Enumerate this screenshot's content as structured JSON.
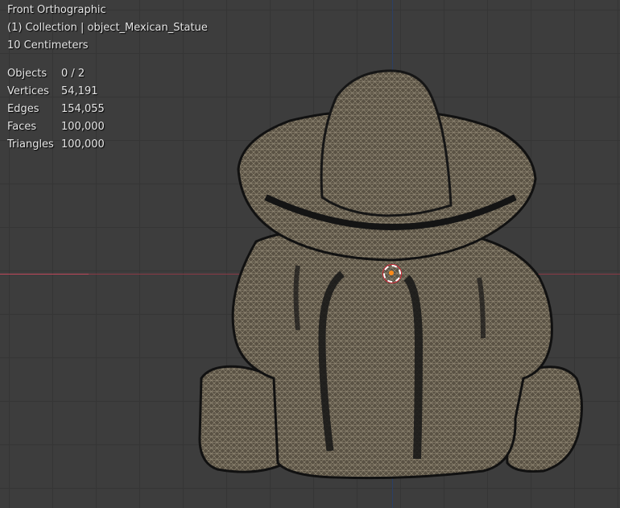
{
  "viewport": {
    "view_name": "Front Orthographic",
    "collection_label": "(1) Collection | object_Mexican_Statue",
    "scale_label": "10 Centimeters"
  },
  "stats": [
    {
      "label": "Objects",
      "value": "0 / 2"
    },
    {
      "label": "Vertices",
      "value": "54,191"
    },
    {
      "label": "Edges",
      "value": "154,055"
    },
    {
      "label": "Faces",
      "value": "100,000"
    },
    {
      "label": "Triangles",
      "value": "100,000"
    }
  ],
  "colors": {
    "background": "#3d3d3d",
    "x_axis": "#c0475a",
    "z_axis": "#2b3f66",
    "origin": "#ff8c1a"
  },
  "icons": [
    "object-origin-icon",
    "3d-cursor-icon"
  ]
}
